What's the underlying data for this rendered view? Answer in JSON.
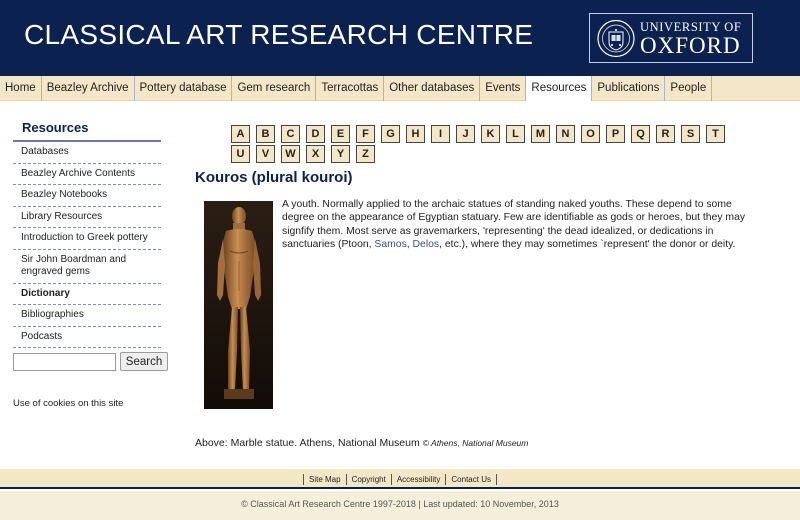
{
  "header": {
    "site_title": "CLASSICAL ART RESEARCH CENTRE",
    "university_line1": "UNIVERSITY OF",
    "university_line2": "OXFORD"
  },
  "nav": {
    "items": [
      {
        "label": "Home"
      },
      {
        "label": "Beazley Archive"
      },
      {
        "label": "Pottery database"
      },
      {
        "label": "Gem research"
      },
      {
        "label": "Terracottas"
      },
      {
        "label": "Other databases"
      },
      {
        "label": "Events"
      },
      {
        "label": "Resources"
      },
      {
        "label": "Publications"
      },
      {
        "label": "People"
      }
    ],
    "active": "Resources"
  },
  "sidebar": {
    "heading": "Resources",
    "items": [
      {
        "label": "Databases"
      },
      {
        "label": "Beazley Archive Contents"
      },
      {
        "label": "Beazley Notebooks"
      },
      {
        "label": "Library Resources"
      },
      {
        "label": "Introduction to Greek pottery"
      },
      {
        "label": "Sir John Boardman and engraved gems"
      },
      {
        "label": "Dictionary"
      },
      {
        "label": "Bibliographies"
      },
      {
        "label": "Podcasts"
      }
    ],
    "current": "Dictionary",
    "search_button": "Search",
    "search_value": "",
    "cookies": "Use of cookies on this site"
  },
  "alphabet": [
    "A",
    "B",
    "C",
    "D",
    "E",
    "F",
    "G",
    "H",
    "I",
    "J",
    "K",
    "L",
    "M",
    "N",
    "O",
    "P",
    "Q",
    "R",
    "S",
    "T",
    "U",
    "V",
    "W",
    "X",
    "Y",
    "Z"
  ],
  "entry": {
    "title": "Kouros (plural kouroi)",
    "text_before": "A youth. Normally applied to the archaic statues of standing naked youths. These depend to some degree on the appearance of Egyptian statuary. Few are identifiable as gods or heroes, but they may signfify them. Most serve as gravemarkers, 'representing' the dead idealized, or dedications in sanctuaries (Ptoon, ",
    "link1": "Samos",
    "sep": ", ",
    "link2": "Delos",
    "text_after": ", etc.), where they may sometimes `represent' the donor or deity.",
    "caption": "Above: Marble statue. Athens, National Museum",
    "caption_credit": "© Athens, National Museum"
  },
  "footer": {
    "links": [
      {
        "label": "Site Map"
      },
      {
        "label": "Copyright"
      },
      {
        "label": "Accessibility"
      },
      {
        "label": "Contact Us"
      }
    ],
    "copyright": "© Classical Art Research Centre 1997-2018 | Last updated: 10 November, 2013"
  },
  "colors": {
    "header_bg": "#0b2150",
    "nav_bg": "#f3e7c8",
    "link": "#3a4c8f"
  }
}
